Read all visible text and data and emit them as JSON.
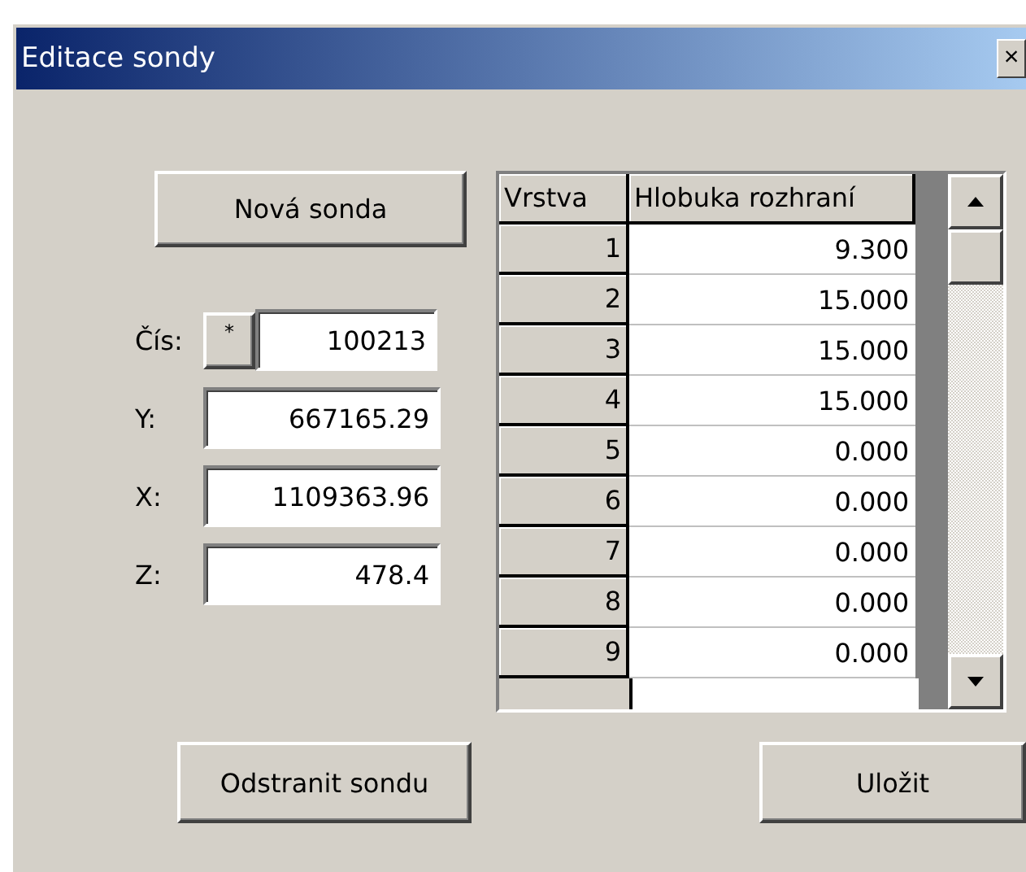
{
  "window": {
    "title": "Editace sondy",
    "close": "×"
  },
  "new_button": "Nová sonda",
  "fields": [
    {
      "label": "Čís:",
      "value": "100213",
      "prefix_button": "*"
    },
    {
      "label": "Y:",
      "value": "667165.29"
    },
    {
      "label": "X:",
      "value": "1109363.96"
    },
    {
      "label": "Z:",
      "value": "478.4"
    }
  ],
  "table": {
    "columns": [
      "Vrstva",
      "Hlobuka rozhraní"
    ],
    "rows": [
      [
        "1",
        "9.300"
      ],
      [
        "2",
        "15.000"
      ],
      [
        "3",
        "15.000"
      ],
      [
        "4",
        "15.000"
      ],
      [
        "5",
        "0.000"
      ],
      [
        "6",
        "0.000"
      ],
      [
        "7",
        "0.000"
      ],
      [
        "8",
        "0.000"
      ],
      [
        "9",
        "0.000"
      ]
    ]
  },
  "buttons": [
    "Odstranit sondu",
    "Uložit"
  ]
}
